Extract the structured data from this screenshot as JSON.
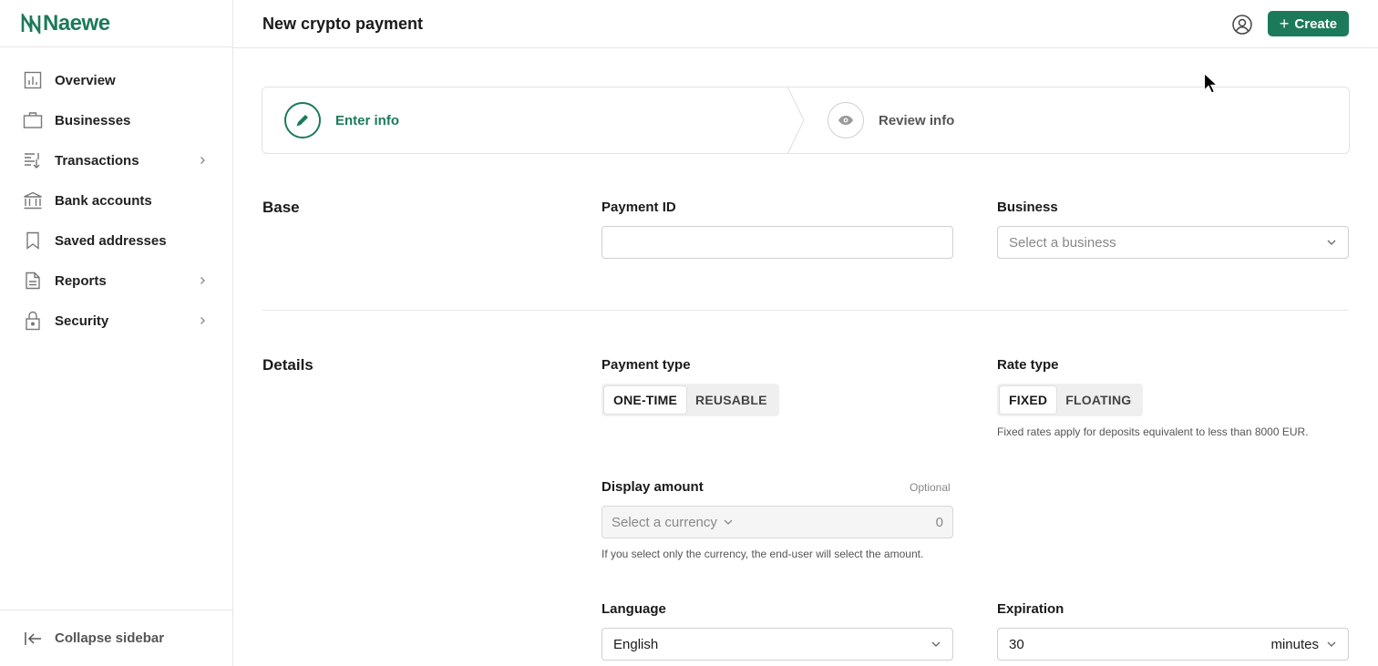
{
  "brand": {
    "name": "Naewe",
    "color": "#1c7a5a"
  },
  "sidebar": {
    "items": [
      {
        "label": "Overview",
        "icon": "bar-chart-icon",
        "has_children": false
      },
      {
        "label": "Businesses",
        "icon": "briefcase-icon",
        "has_children": false
      },
      {
        "label": "Transactions",
        "icon": "transactions-icon",
        "has_children": true
      },
      {
        "label": "Bank accounts",
        "icon": "bank-icon",
        "has_children": false
      },
      {
        "label": "Saved addresses",
        "icon": "bookmark-icon",
        "has_children": false
      },
      {
        "label": "Reports",
        "icon": "document-icon",
        "has_children": true
      },
      {
        "label": "Security",
        "icon": "lock-icon",
        "has_children": true
      }
    ],
    "collapse_label": "Collapse sidebar"
  },
  "header": {
    "title": "New crypto payment",
    "create_label": "Create"
  },
  "stepper": {
    "steps": [
      {
        "label": "Enter info",
        "icon": "pencil-icon",
        "state": "active"
      },
      {
        "label": "Review info",
        "icon": "eye-icon",
        "state": "inactive"
      }
    ]
  },
  "base": {
    "title": "Base",
    "payment_id": {
      "label": "Payment ID",
      "value": "",
      "placeholder": ""
    },
    "business": {
      "label": "Business",
      "placeholder": "Select a business"
    }
  },
  "details": {
    "title": "Details",
    "payment_type": {
      "label": "Payment type",
      "options": [
        "ONE-TIME",
        "REUSABLE"
      ],
      "selected": "ONE-TIME"
    },
    "rate_type": {
      "label": "Rate type",
      "options": [
        "FIXED",
        "FLOATING"
      ],
      "selected": "FIXED",
      "help": "Fixed rates apply for deposits equivalent to less than 8000 EUR."
    },
    "display_amount": {
      "label": "Display amount",
      "optional": "Optional",
      "currency_placeholder": "Select a currency",
      "amount_placeholder": "0",
      "help": "If you select only the currency, the end-user will select the amount."
    },
    "language": {
      "label": "Language",
      "value": "English"
    },
    "expiration": {
      "label": "Expiration",
      "value": "30",
      "unit": "minutes"
    }
  }
}
